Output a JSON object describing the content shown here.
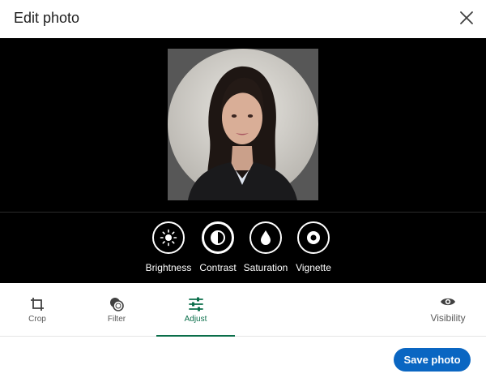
{
  "dialog": {
    "title": "Edit photo"
  },
  "adjust_options": [
    {
      "label": "Brightness",
      "icon": "brightness-icon"
    },
    {
      "label": "Contrast",
      "icon": "contrast-icon"
    },
    {
      "label": "Saturation",
      "icon": "saturation-icon"
    },
    {
      "label": "Vignette",
      "icon": "vignette-icon"
    }
  ],
  "tabs": [
    {
      "label": "Crop",
      "icon": "crop-icon"
    },
    {
      "label": "Filter",
      "icon": "filter-icon"
    },
    {
      "label": "Adjust",
      "icon": "sliders-icon",
      "active": true
    },
    {
      "label": "Visibility",
      "icon": "eye-icon"
    }
  ],
  "footer": {
    "save_label": "Save photo"
  },
  "colors": {
    "accent": "#0a66c2",
    "active_tab": "#0a6e4a",
    "stage_bg": "#000000"
  }
}
